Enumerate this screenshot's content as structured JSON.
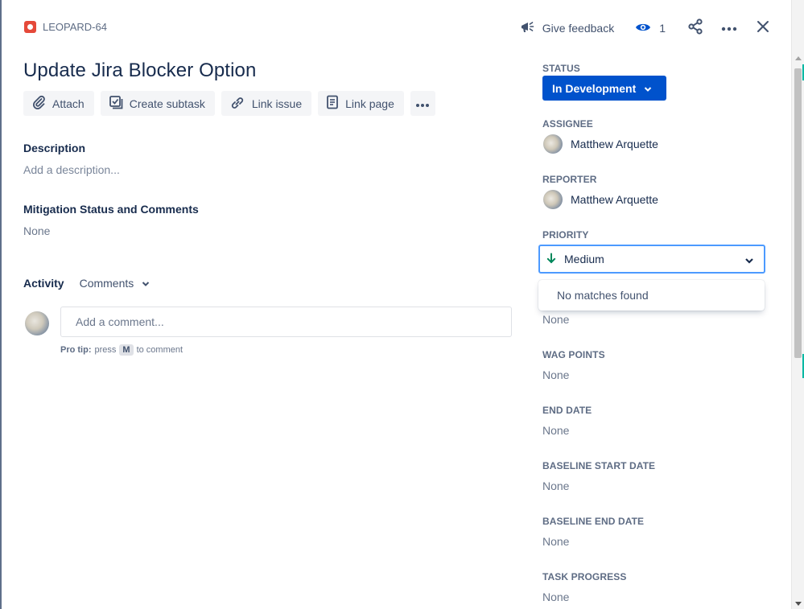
{
  "header": {
    "issue_key": "LEOPARD-64",
    "feedback_label": "Give feedback",
    "watch_count": "1"
  },
  "issue": {
    "title": "Update Jira Blocker Option"
  },
  "toolbar": {
    "attach": "Attach",
    "create_subtask": "Create subtask",
    "link_issue": "Link issue",
    "link_page": "Link page"
  },
  "description": {
    "label": "Description",
    "placeholder": "Add a description..."
  },
  "mitigation": {
    "label": "Mitigation Status and Comments",
    "value": "None"
  },
  "activity": {
    "label": "Activity",
    "filter": "Comments",
    "comment_placeholder": "Add a comment...",
    "protip_bold": "Pro tip:",
    "protip_press": "press",
    "protip_key": "M",
    "protip_rest": "to comment"
  },
  "sidebar": {
    "status_label": "STATUS",
    "status_value": "In Development",
    "assignee_label": "ASSIGNEE",
    "assignee_name": "Matthew Arquette",
    "reporter_label": "REPORTER",
    "reporter_name": "Matthew Arquette",
    "priority_label": "PRIORITY",
    "priority_value": "Medium",
    "priority_dropdown_message": "No matches found",
    "hidden_field_value": "None",
    "wag_points_label": "WAG POINTS",
    "wag_points_value": "None",
    "end_date_label": "END DATE",
    "end_date_value": "None",
    "baseline_start_label": "BASELINE START DATE",
    "baseline_start_value": "None",
    "baseline_end_label": "BASELINE END DATE",
    "baseline_end_value": "None",
    "task_progress_label": "TASK PROGRESS",
    "task_progress_value": "None"
  },
  "colors": {
    "primary": "#0052cc",
    "issue_type": "#e5493a",
    "priority_medium_arrow": "#00875a",
    "focus_ring": "#4c9aff"
  }
}
